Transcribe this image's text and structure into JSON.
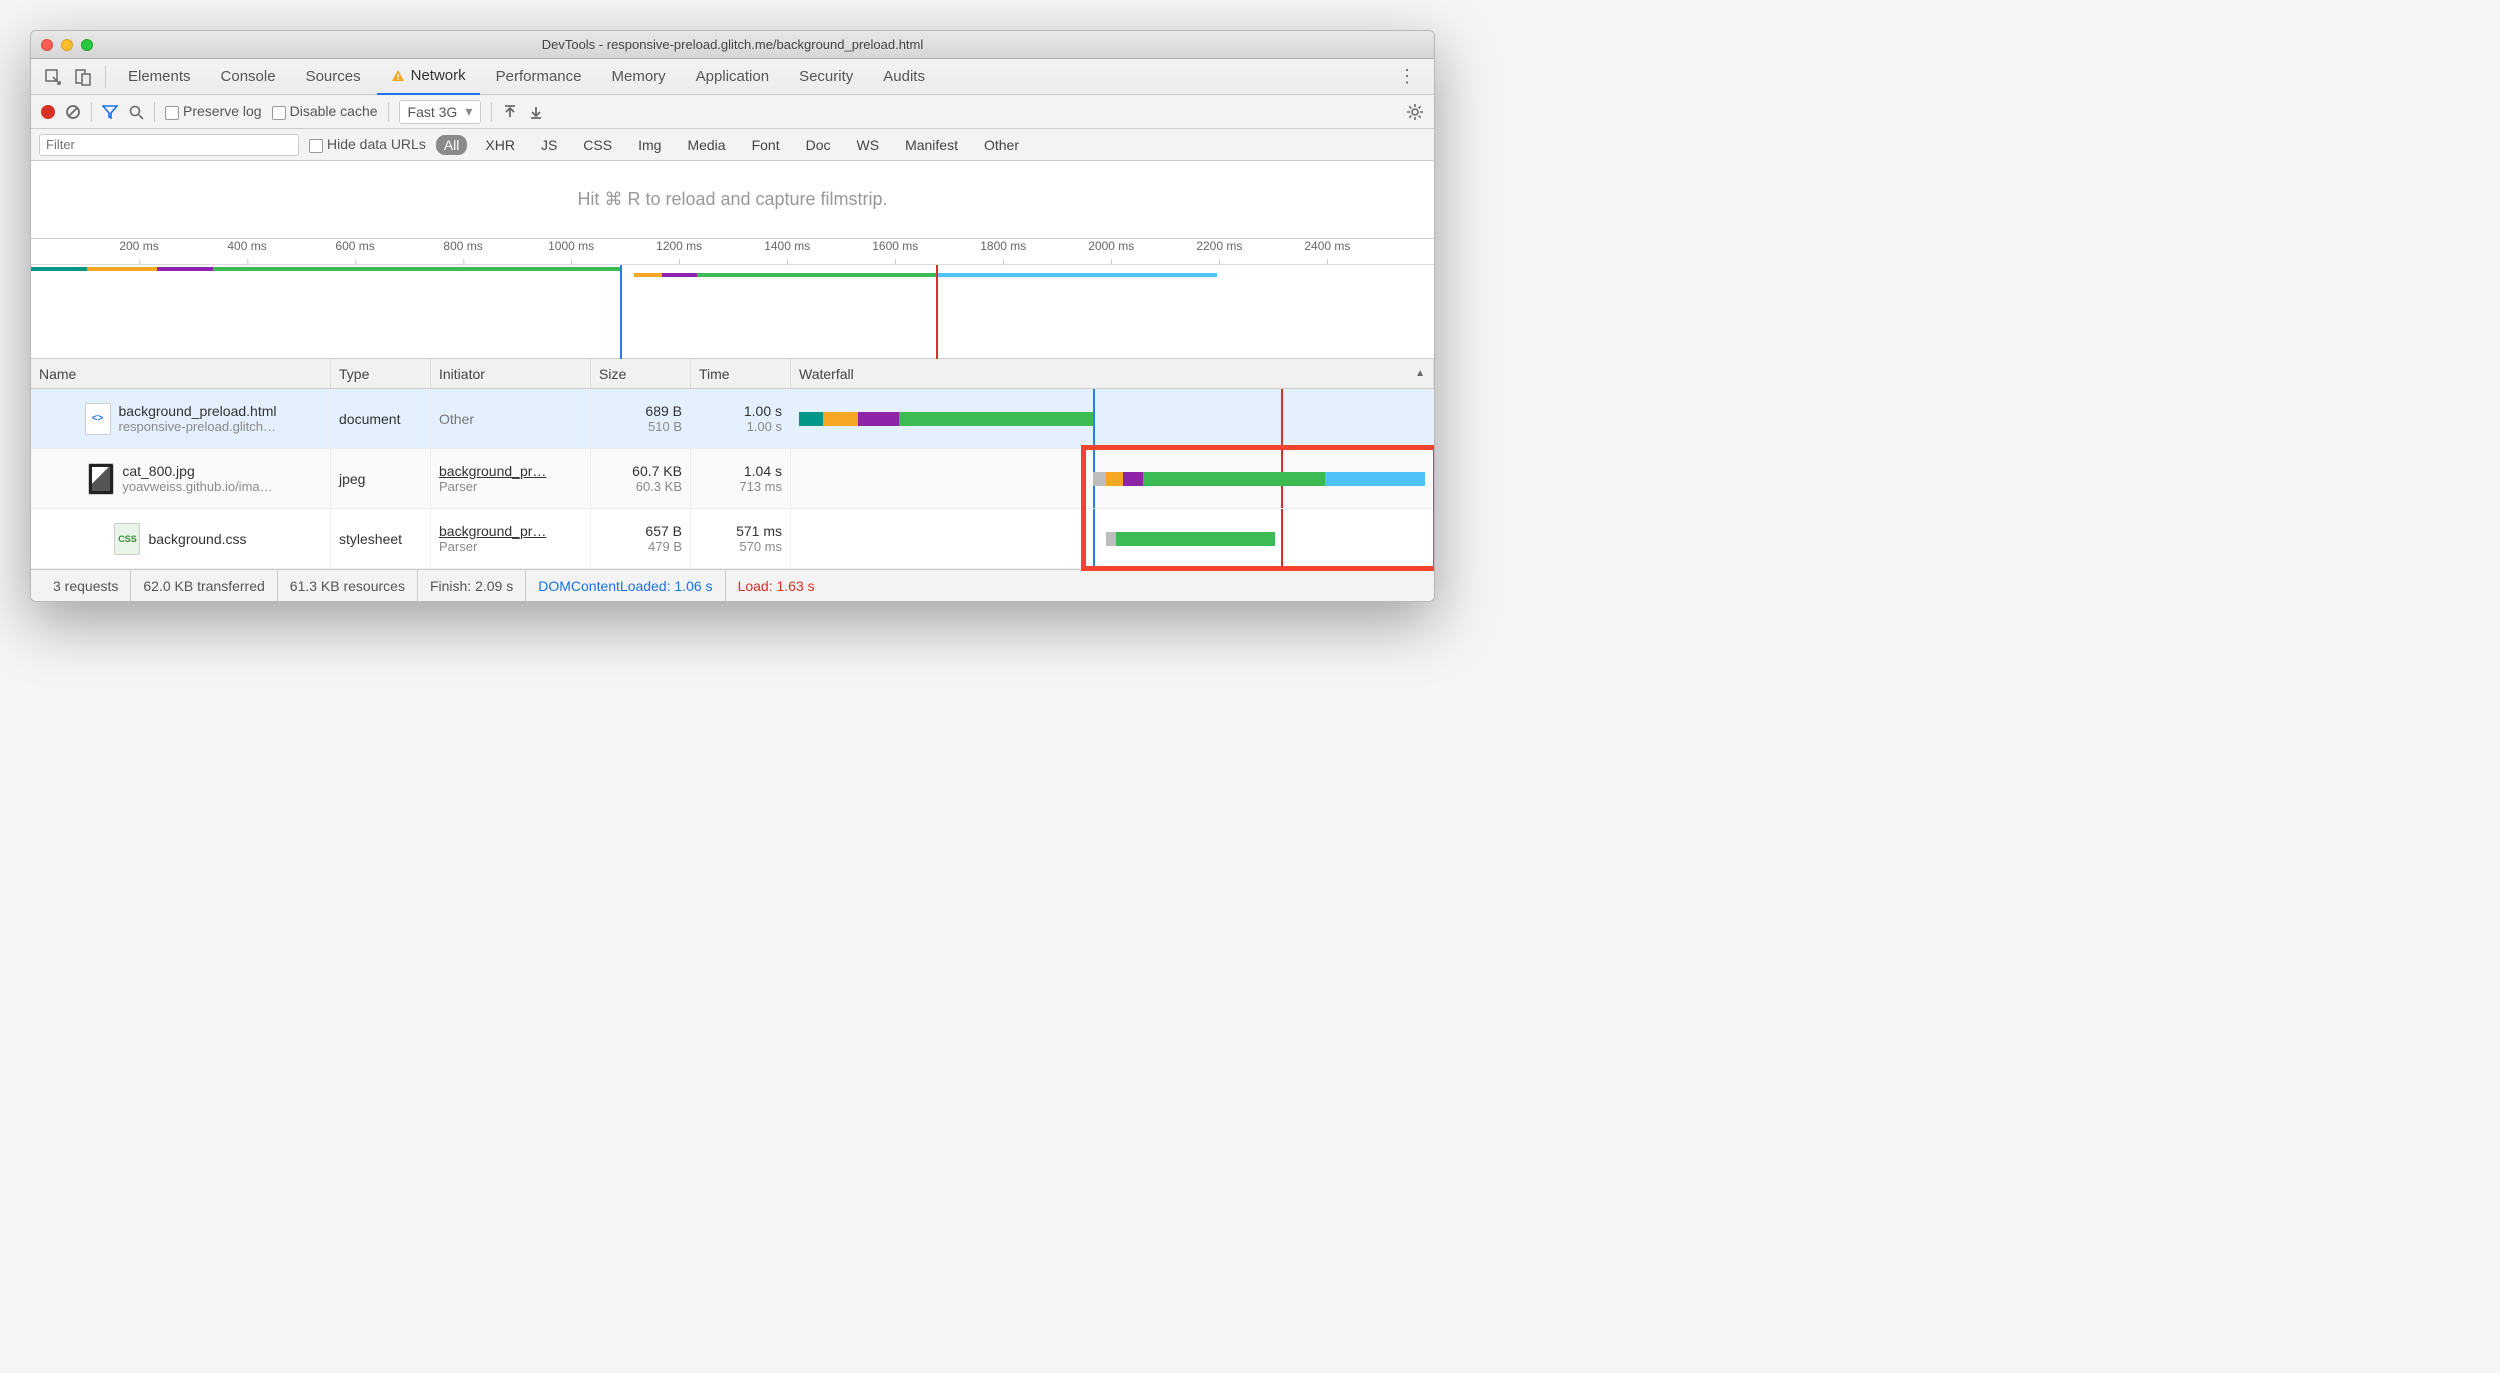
{
  "window": {
    "title": "DevTools - responsive-preload.glitch.me/background_preload.html"
  },
  "tabs": {
    "items": [
      "Elements",
      "Console",
      "Sources",
      "Network",
      "Performance",
      "Memory",
      "Application",
      "Security",
      "Audits"
    ],
    "active": "Network"
  },
  "toolbar": {
    "preserve_log": "Preserve log",
    "disable_cache": "Disable cache",
    "throttle": "Fast 3G"
  },
  "filterbar": {
    "filter_placeholder": "Filter",
    "hide_data_urls": "Hide data URLs",
    "types": [
      "All",
      "XHR",
      "JS",
      "CSS",
      "Img",
      "Media",
      "Font",
      "Doc",
      "WS",
      "Manifest",
      "Other"
    ],
    "active_type": "All"
  },
  "filmstrip": {
    "hint": "Hit ⌘ R to reload and capture filmstrip."
  },
  "overview": {
    "ticks": [
      "200 ms",
      "400 ms",
      "600 ms",
      "800 ms",
      "1000 ms",
      "1200 ms",
      "1400 ms",
      "1600 ms",
      "1800 ms",
      "2000 ms",
      "2200 ms",
      "2400 ms"
    ]
  },
  "columns": {
    "name": "Name",
    "type": "Type",
    "initiator": "Initiator",
    "size": "Size",
    "time": "Time",
    "waterfall": "Waterfall"
  },
  "requests": [
    {
      "name": "background_preload.html",
      "sub": "responsive-preload.glitch…",
      "type": "document",
      "initiator": "Other",
      "initiator_sub": "",
      "size": "689 B",
      "size_sub": "510 B",
      "time": "1.00 s",
      "time_sub": "1.00 s",
      "icon": "html"
    },
    {
      "name": "cat_800.jpg",
      "sub": "yoavweiss.github.io/ima…",
      "type": "jpeg",
      "initiator": "background_pr…",
      "initiator_sub": "Parser",
      "size": "60.7 KB",
      "size_sub": "60.3 KB",
      "time": "1.04 s",
      "time_sub": "713 ms",
      "icon": "img"
    },
    {
      "name": "background.css",
      "sub": "",
      "type": "stylesheet",
      "initiator": "background_pr…",
      "initiator_sub": "Parser",
      "size": "657 B",
      "size_sub": "479 B",
      "time": "571 ms",
      "time_sub": "570 ms",
      "icon": "css"
    }
  ],
  "status": {
    "requests": "3 requests",
    "transferred": "62.0 KB transferred",
    "resources": "61.3 KB resources",
    "finish": "Finish: 2.09 s",
    "dcl": "DOMContentLoaded: 1.06 s",
    "load": "Load: 1.63 s"
  },
  "colors": {
    "blue": "#2b7de9",
    "red": "#d93025",
    "green": "#3cba54",
    "orange": "#f5a623",
    "purple": "#8e24aa",
    "teal": "#009688",
    "ltblue": "#4fc3f7",
    "grey": "#bdbdbd"
  }
}
